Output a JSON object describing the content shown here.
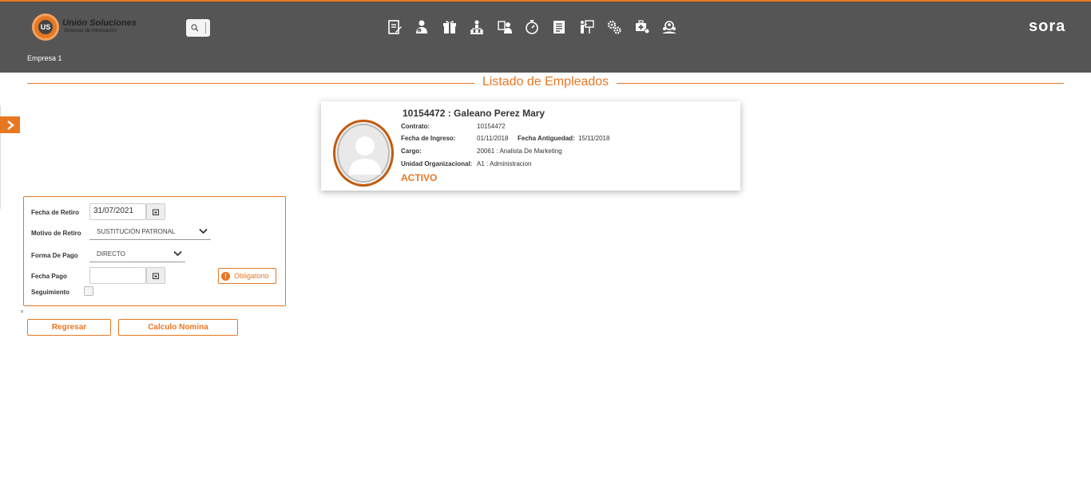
{
  "header": {
    "logo_mark": "US",
    "logo_name": "Unión Soluciones",
    "logo_tagline": "Sistemas de Información",
    "company": "Empresa 1",
    "brand": "sora",
    "accent_color": "#e87722",
    "bar_color": "#555555",
    "nav_icons": [
      "document-edit-icon",
      "employee-money-icon",
      "gift-icon",
      "org-chart-icon",
      "employee-id-icon",
      "stopwatch-icon",
      "report-list-icon",
      "training-board-icon",
      "settings-gears-icon",
      "health-insurance-icon",
      "team-search-icon"
    ]
  },
  "page": {
    "title": "Listado de Empleados"
  },
  "employee": {
    "heading": "10154472 : Galeano Perez Mary",
    "contrato_label": "Contrato:",
    "contrato_value": "10154472",
    "ingreso_label": "Fecha de Ingreso:",
    "ingreso_value": "01/11/2018",
    "antiguedad_label": "Fecha Antiguedad:",
    "antiguedad_value": "15/11/2018",
    "cargo_label": "Cargo:",
    "cargo_value": "20061 : Analista De Marketing",
    "unidad_label": "Unidad Organizacional:",
    "unidad_value": "A1 : Administracion",
    "estado": "ACTIVO"
  },
  "form": {
    "fecha_retiro_label": "Fecha de Retiro",
    "fecha_retiro_value": "31/07/2021",
    "motivo_label": "Motivo de Retiro",
    "motivo_value": "SUSTITUCIÓN PATRONAL",
    "forma_pago_label": "Forma De Pago",
    "forma_pago_value": "DIRECTO",
    "fecha_pago_label": "Fecha Pago",
    "fecha_pago_value": "",
    "obligatorio": "Obligatorio",
    "seguimiento_label": "Seguimiento",
    "seguimiento_checked": false
  },
  "actions": {
    "regresar": "Regresar",
    "calculo": "Calculo Nomina"
  }
}
